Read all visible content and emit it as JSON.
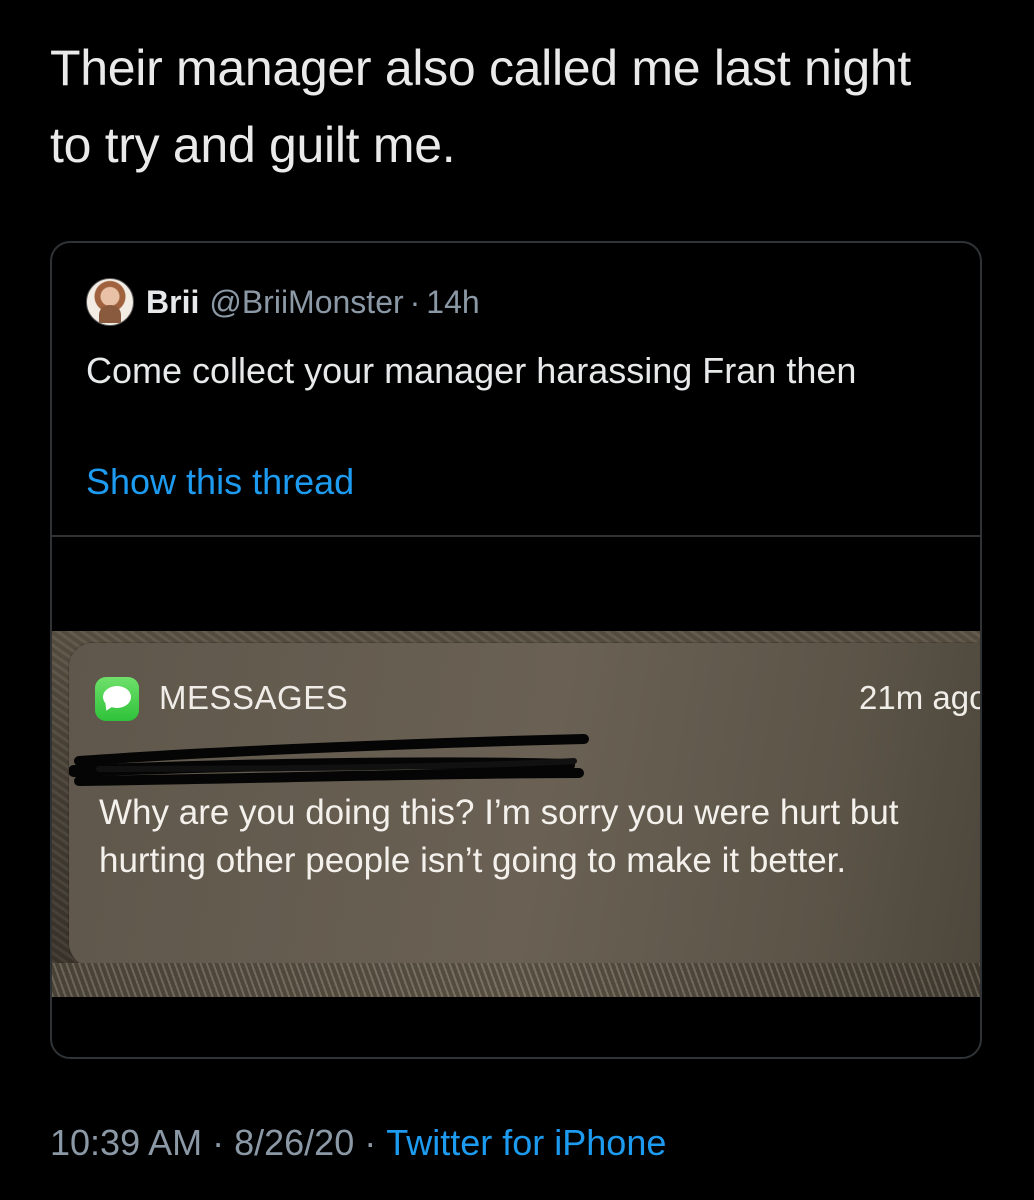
{
  "tweet": {
    "text": "Their manager also called me last night to try and guilt me."
  },
  "quote": {
    "name": "Brii",
    "handle": "@BriiMonster",
    "dot": "·",
    "time": "14h",
    "text": "Come collect your manager harassing Fran then",
    "show_thread": "Show this thread"
  },
  "notification": {
    "app_icon": "messages-icon",
    "app_name": "MESSAGES",
    "time": "21m ago",
    "message": "Why are you doing this? I’m sorry you were hurt but hurting other people isn’t going to make it better."
  },
  "footer": {
    "time": "10:39 AM",
    "date": "8/26/20",
    "separator": "·",
    "source": "Twitter for iPhone"
  },
  "colors": {
    "background": "#000000",
    "link": "#1d9bf0",
    "secondary_text": "#8b98a5",
    "messages_green": "#34c759"
  }
}
